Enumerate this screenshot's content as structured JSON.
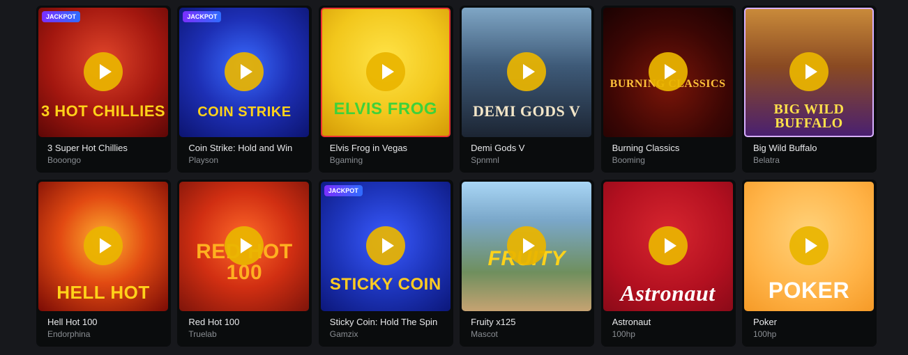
{
  "games": [
    {
      "title": "3 Super Hot Chillies",
      "provider": "Booongo",
      "jackpot": "JACKPOT",
      "art": "3 HOT CHILLIES",
      "art_color": "#ffd21a"
    },
    {
      "title": "Coin Strike: Hold and Win",
      "provider": "Playson",
      "jackpot": "JACKPOT",
      "art": "COIN STRIKE",
      "art_color": "#ffd21a"
    },
    {
      "title": "Elvis Frog in Vegas",
      "provider": "Bgaming",
      "jackpot": "",
      "art": "ELVIS FROG",
      "art_color": "#3fd13a"
    },
    {
      "title": "Demi Gods V",
      "provider": "Spnmnl",
      "jackpot": "",
      "art": "DEMI GODS V",
      "art_color": "#f3e6c8"
    },
    {
      "title": "Burning Classics",
      "provider": "Booming",
      "jackpot": "",
      "art": "BURNING CLASSICS",
      "art_color": "#ffc23a"
    },
    {
      "title": "Big Wild Buffalo",
      "provider": "Belatra",
      "jackpot": "",
      "art": "BIG WILD BUFFALO",
      "art_color": "#ffe14a"
    },
    {
      "title": "Hell Hot 100",
      "provider": "Endorphina",
      "jackpot": "",
      "art": "HELL HOT",
      "art_color": "#ffd21a"
    },
    {
      "title": "Red Hot 100",
      "provider": "Truelab",
      "jackpot": "",
      "art": "RED HOT 100",
      "art_color": "#ffb020"
    },
    {
      "title": "Sticky Coin: Hold The Spin",
      "provider": "Gamzix",
      "jackpot": "JACKPOT",
      "art": "STICKY COIN",
      "art_color": "#ffcc22"
    },
    {
      "title": "Fruity x125",
      "provider": "Mascot",
      "jackpot": "",
      "art": "FRUITY",
      "art_color": "#ffd21a"
    },
    {
      "title": "Astronaut",
      "provider": "100hp",
      "jackpot": "",
      "art": "Astronaut",
      "art_color": "#ffffff"
    },
    {
      "title": "Poker",
      "provider": "100hp",
      "jackpot": "",
      "art": "POKER",
      "art_color": "#ffffff"
    }
  ]
}
